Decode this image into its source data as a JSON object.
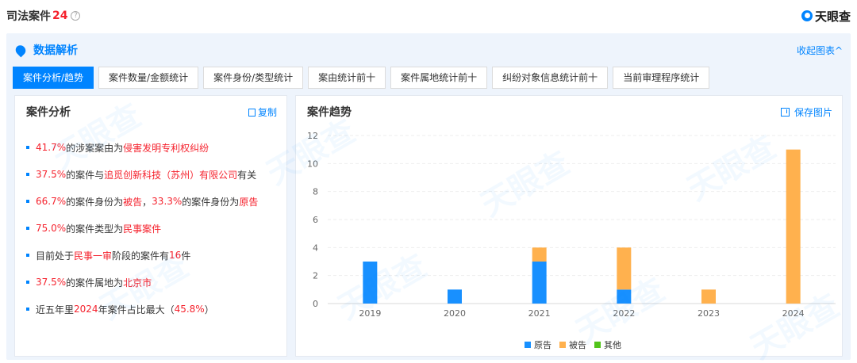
{
  "header": {
    "title": "司法案件",
    "count": "24",
    "help_glyph": "?",
    "brand_name": "天眼查"
  },
  "panel": {
    "title": "数据解析",
    "collapse_label": "收起图表^"
  },
  "tabs": [
    {
      "label": "案件分析/趋势",
      "active": true
    },
    {
      "label": "案件数量/金额统计",
      "active": false
    },
    {
      "label": "案件身份/类型统计",
      "active": false
    },
    {
      "label": "案由统计前十",
      "active": false
    },
    {
      "label": "案件属地统计前十",
      "active": false
    },
    {
      "label": "纠纷对象信息统计前十",
      "active": false
    },
    {
      "label": "当前审理程序统计",
      "active": false
    }
  ],
  "analysis": {
    "title": "案件分析",
    "copy_label": "复制",
    "items": [
      [
        {
          "t": "41.7%",
          "h": true
        },
        {
          "t": "的涉案案由为",
          "h": false
        },
        {
          "t": "侵害发明专利权纠纷",
          "h": true
        }
      ],
      [
        {
          "t": "37.5%",
          "h": true
        },
        {
          "t": "的案件与",
          "h": false
        },
        {
          "t": "追觅创新科技（苏州）有限公司",
          "h": true
        },
        {
          "t": "有关",
          "h": false
        }
      ],
      [
        {
          "t": "66.7%",
          "h": true
        },
        {
          "t": "的案件身份为",
          "h": false
        },
        {
          "t": "被告",
          "h": true
        },
        {
          "t": "，",
          "h": false
        },
        {
          "t": "33.3%",
          "h": true
        },
        {
          "t": "的案件身份为",
          "h": false
        },
        {
          "t": "原告",
          "h": true
        }
      ],
      [
        {
          "t": "75.0%",
          "h": true
        },
        {
          "t": "的案件类型为",
          "h": false
        },
        {
          "t": "民事案件",
          "h": true
        }
      ],
      [
        {
          "t": "目前处于",
          "h": false
        },
        {
          "t": "民事一审",
          "h": true
        },
        {
          "t": "阶段的案件有",
          "h": false
        },
        {
          "t": "16",
          "h": true
        },
        {
          "t": "件",
          "h": false
        }
      ],
      [
        {
          "t": "37.5%",
          "h": true
        },
        {
          "t": "的案件属地为",
          "h": false
        },
        {
          "t": "北京市",
          "h": true
        }
      ],
      [
        {
          "t": "近五年里",
          "h": false
        },
        {
          "t": "2024",
          "h": true
        },
        {
          "t": "年案件占比最大（",
          "h": false
        },
        {
          "t": "45.8%",
          "h": true
        },
        {
          "t": "）",
          "h": false
        }
      ]
    ]
  },
  "trend": {
    "title": "案件趋势",
    "save_label": "保存图片"
  },
  "chart_data": {
    "type": "bar",
    "stacked": true,
    "categories": [
      "2019",
      "2020",
      "2021",
      "2022",
      "2023",
      "2024"
    ],
    "series": [
      {
        "name": "原告",
        "color": "#1890ff",
        "values": [
          3,
          1,
          3,
          1,
          0,
          0
        ]
      },
      {
        "name": "被告",
        "color": "#ffb14e",
        "values": [
          0,
          0,
          1,
          3,
          1,
          11
        ]
      },
      {
        "name": "其他",
        "color": "#52c41a",
        "values": [
          0,
          0,
          0,
          0,
          0,
          0
        ]
      }
    ],
    "ylim": [
      0,
      12
    ],
    "yticks": [
      0,
      2,
      4,
      6,
      8,
      10,
      12
    ],
    "grid": true,
    "legend": "bottom"
  },
  "watermark_text": "天眼查"
}
